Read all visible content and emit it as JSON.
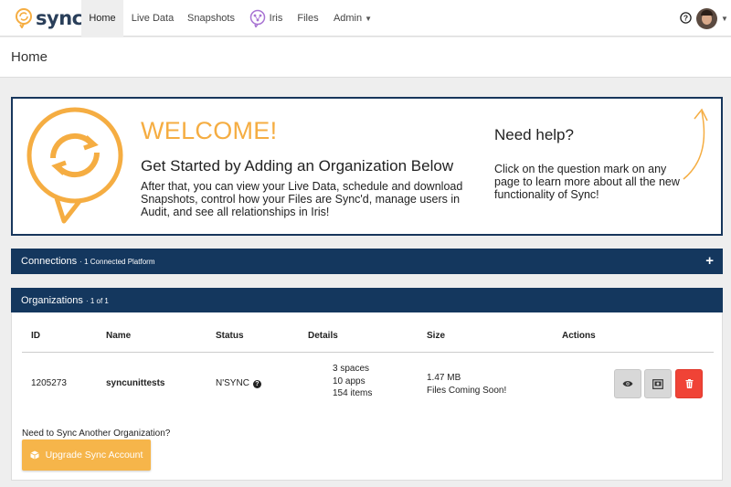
{
  "nav": {
    "logo_text": "sync",
    "items": [
      {
        "label": "Home"
      },
      {
        "label": "Live Data"
      },
      {
        "label": "Snapshots"
      },
      {
        "label": "Iris"
      },
      {
        "label": "Files"
      },
      {
        "label": "Admin"
      }
    ],
    "active": "Home"
  },
  "page": {
    "title": "Home"
  },
  "welcome": {
    "heading": "WELCOME!",
    "subheading": "Get Started by Adding an Organization Below",
    "body": "After that, you can view your Live Data, schedule and download Snapshots, control how your Files are Sync'd, manage users in Audit, and see all relationships in Iris!",
    "help_heading": "Need help?",
    "help_body": "Click on the question mark on any page to learn more about all the new functionality of Sync!"
  },
  "connections": {
    "title": "Connections",
    "subtitle": "· 1 Connected Platform",
    "add_label": "+"
  },
  "organizations": {
    "title": "Organizations",
    "subtitle": "· 1 of 1",
    "columns": [
      "ID",
      "Name",
      "Status",
      "Details",
      "Size",
      "Actions"
    ],
    "rows": [
      {
        "id": "1205273",
        "name": "syncunittests",
        "status": "N'SYNC",
        "details": [
          "3 spaces",
          "10 apps",
          "154 items"
        ],
        "size": [
          "1.47 MB",
          "Files Coming Soon!"
        ],
        "actions": [
          "eye-icon",
          "snapshot-icon",
          "trash-icon"
        ]
      }
    ],
    "another_prompt": "Need to Sync Another Organization?",
    "upgrade_label": "Upgrade Sync Account"
  },
  "colors": {
    "brand_orange": "#f5ad42",
    "navy": "#14375e",
    "danger": "#f04336"
  }
}
